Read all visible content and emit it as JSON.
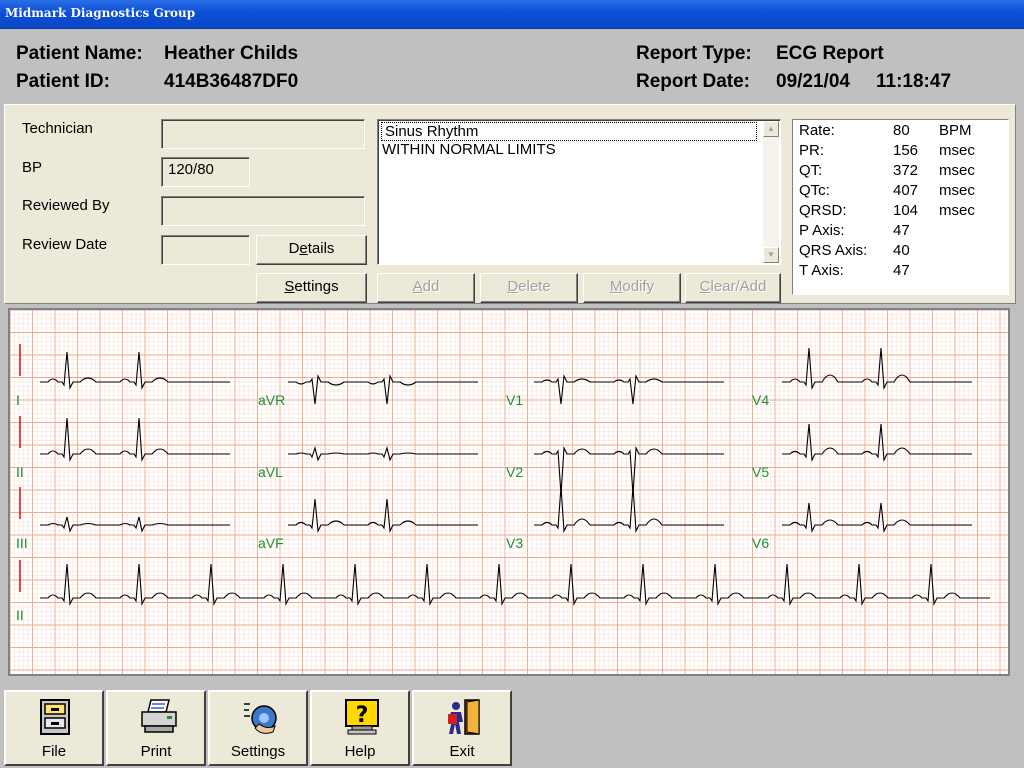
{
  "window": {
    "title": "Midmark Diagnostics Group"
  },
  "header": {
    "patient_name_label": "Patient Name:",
    "patient_name": "Heather Childs",
    "patient_id_label": "Patient ID:",
    "patient_id": "414B36487DF0",
    "report_type_label": "Report Type:",
    "report_type": "ECG Report",
    "report_date_label": "Report Date:",
    "report_date": "09/21/04",
    "report_time": "11:18:47"
  },
  "form": {
    "technician_label": "Technician",
    "technician_value": "",
    "bp_label": "BP",
    "bp_value": "120/80",
    "reviewed_by_label": "Reviewed By",
    "reviewed_by_value": "",
    "review_date_label": "Review Date",
    "review_date_value": "",
    "details_button": "Details",
    "settings_button": "Settings"
  },
  "interpretation": {
    "items": [
      "Sinus Rhythm",
      "WITHIN NORMAL LIMITS"
    ],
    "add_button": "Add",
    "delete_button": "Delete",
    "modify_button": "Modify",
    "clearadd_button": "Clear/Add"
  },
  "measurements": [
    {
      "label": "Rate:",
      "value": "80",
      "unit": "BPM"
    },
    {
      "label": "PR:",
      "value": "156",
      "unit": "msec"
    },
    {
      "label": "QT:",
      "value": "372",
      "unit": "msec"
    },
    {
      "label": "QTc:",
      "value": "407",
      "unit": "msec"
    },
    {
      "label": "QRSD:",
      "value": "104",
      "unit": "msec"
    },
    {
      "label": "P Axis:",
      "value": "47",
      "unit": ""
    },
    {
      "label": "QRS Axis:",
      "value": "40",
      "unit": ""
    },
    {
      "label": "T Axis:",
      "value": "47",
      "unit": ""
    }
  ],
  "ecg": {
    "leads": [
      "I",
      "aVR",
      "V1",
      "V4",
      "II",
      "aVL",
      "V2",
      "V5",
      "III",
      "aVF",
      "V3",
      "V6",
      "II"
    ],
    "grid_minor_color": "#f6d4c4",
    "grid_major_color": "#eea98f",
    "trace_color": "#000000",
    "calibration_color": "#cc0000",
    "label_color": "#1f8f3a"
  },
  "toolbar": {
    "items": [
      {
        "label": "File",
        "icon": "file-cabinet-icon"
      },
      {
        "label": "Print",
        "icon": "printer-icon"
      },
      {
        "label": "Settings",
        "icon": "settings-dial-icon"
      },
      {
        "label": "Help",
        "icon": "help-question-icon"
      },
      {
        "label": "Exit",
        "icon": "exit-door-icon"
      }
    ]
  }
}
